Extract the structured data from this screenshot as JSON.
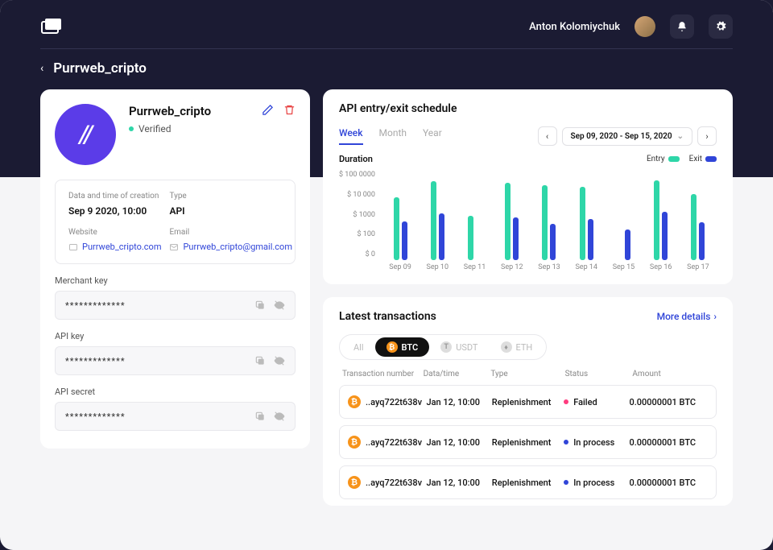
{
  "header": {
    "username": "Anton Kolomiychuk"
  },
  "breadcrumb": {
    "title": "Purrweb_cripto"
  },
  "profile": {
    "name": "Purrweb_cripto",
    "verified_label": "Verified",
    "info": {
      "created_label": "Data and time of creation",
      "created_value": "Sep 9 2020, 10:00",
      "type_label": "Type",
      "type_value": "API",
      "website_label": "Website",
      "website_value": "Purrweb_cripto.com",
      "email_label": "Email",
      "email_value": "Purrweb_cripto@gmail.com"
    },
    "keys": {
      "merchant_label": "Merchant key",
      "merchant_value": "*************",
      "api_label": "API key",
      "api_value": "*************",
      "secret_label": "API secret",
      "secret_value": "*************"
    }
  },
  "chart": {
    "title": "API entry/exit schedule",
    "tabs": {
      "week": "Week",
      "month": "Month",
      "year": "Year"
    },
    "date_range": "Sep 09, 2020 - Sep 15, 2020",
    "duration_label": "Duration",
    "legend": {
      "entry": "Entry",
      "exit": "Exit"
    },
    "y_ticks": [
      "$ 100 0000",
      "$ 10 000",
      "$ 1000",
      "$ 100",
      "$ 0"
    ]
  },
  "chart_data": {
    "type": "bar",
    "categories": [
      "Sep 09",
      "Sep 10",
      "Sep 11",
      "Sep 12",
      "Sep 13",
      "Sep 14",
      "Sep 15",
      "Sep 16",
      "Sep 17"
    ],
    "series": [
      {
        "name": "Entry",
        "values": [
          50000,
          800000,
          2000,
          600000,
          400000,
          300000,
          0,
          900000,
          80000
        ]
      },
      {
        "name": "Exit",
        "values": [
          800,
          3000,
          0,
          1500,
          500,
          1200,
          200,
          4000,
          700
        ]
      }
    ],
    "ylabel": "Duration",
    "yscale": "log",
    "ylim": [
      0,
      1000000
    ]
  },
  "transactions": {
    "title": "Latest transactions",
    "more_label": "More details",
    "coin_tabs": {
      "all": "All",
      "btc": "BTC",
      "usdt": "USDT",
      "eth": "ETH"
    },
    "columns": {
      "number": "Transaction number",
      "datetime": "Data/time",
      "type": "Type",
      "status": "Status",
      "amount": "Amount"
    },
    "rows": [
      {
        "number": "..ayq722t638v",
        "datetime": "Jan 12, 10:00",
        "type": "Replenishment",
        "status": "Failed",
        "status_kind": "failed",
        "amount": "0.00000001 BTC"
      },
      {
        "number": "..ayq722t638v",
        "datetime": "Jan 12, 10:00",
        "type": "Replenishment",
        "status": "In process",
        "status_kind": "process",
        "amount": "0.00000001 BTC"
      },
      {
        "number": "..ayq722t638v",
        "datetime": "Jan 12, 10:00",
        "type": "Replenishment",
        "status": "In process",
        "status_kind": "process",
        "amount": "0.00000001 BTC"
      }
    ]
  }
}
